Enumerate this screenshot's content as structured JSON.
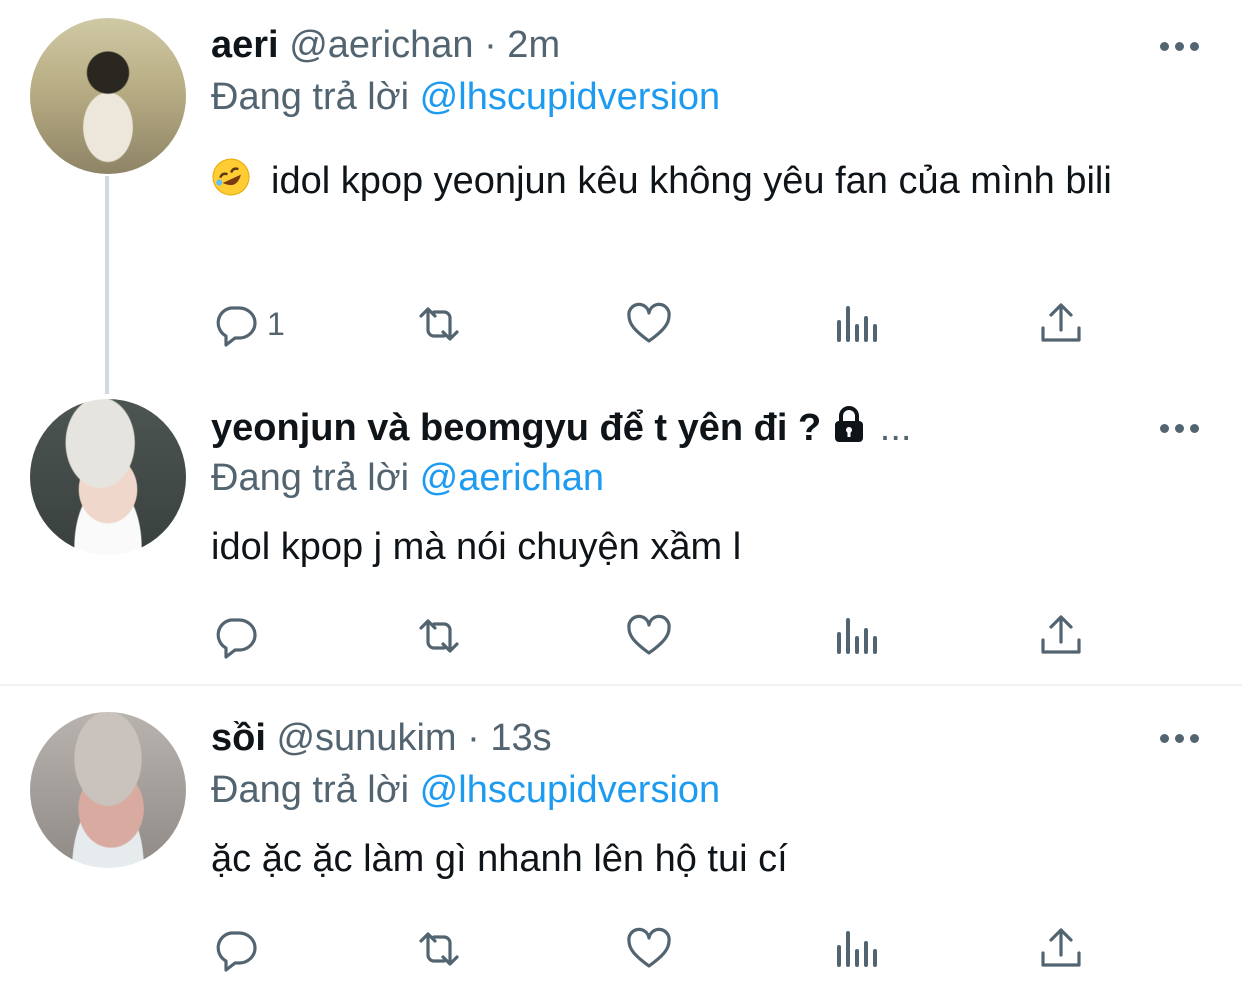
{
  "tweets": [
    {
      "name": "aeri",
      "handle": "@aerichan",
      "time": "· 2m",
      "reply_prefix": "Đang trả lời",
      "reply_to": "@lhscupidversion",
      "emoji": "rolling-on-floor-laughing-emoji",
      "text": "idol kpop yeonjun kêu không yêu fan của mình bili",
      "reply_count": "1"
    },
    {
      "name": "yeonjun và beomgyu để t yên đi ?",
      "protected_icon": "lock-icon",
      "name_overflow": "...",
      "reply_prefix": "Đang trả lời",
      "reply_to": "@aerichan",
      "text": "idol kpop j mà nói chuyện xầm l"
    },
    {
      "name": "sồi",
      "handle": "@sunukim",
      "time": "· 13s",
      "reply_prefix": "Đang trả lời",
      "reply_to": "@lhscupidversion",
      "text": "ặc ặc ặc làm gì nhanh lên hộ tui cí"
    }
  ],
  "icons": {
    "reply": "reply-icon",
    "retweet": "retweet-icon",
    "like": "heart-icon",
    "views": "analytics-icon",
    "share": "share-icon",
    "more": "more-icon"
  },
  "colors": {
    "link": "#1d9bf0",
    "secondary_text": "#536471",
    "primary_text": "#0f1419",
    "thread_line": "#cfd9de"
  }
}
